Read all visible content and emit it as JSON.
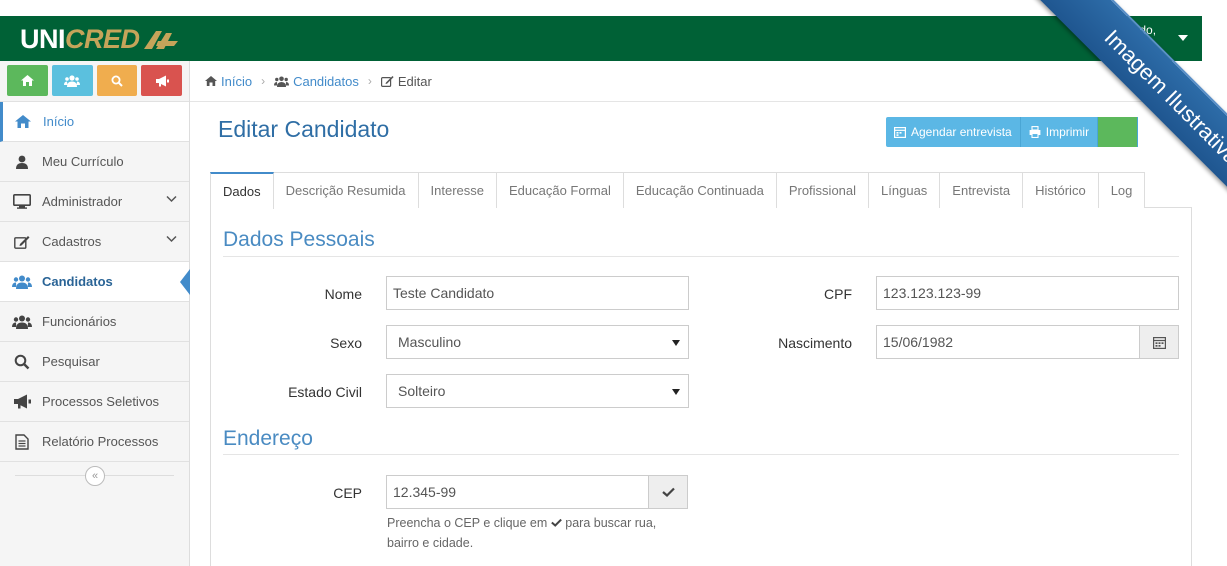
{
  "header": {
    "brand_part1": "UNI",
    "brand_part2": "CRED",
    "welcome": "em vindo,",
    "user_name": "erize"
  },
  "ribbon": {
    "text": "Imagem Ilustrativa"
  },
  "quick_buttons": [
    {
      "icon": "home-icon",
      "color": "#5cb85c"
    },
    {
      "icon": "users-icon",
      "color": "#5bc0de"
    },
    {
      "icon": "search-icon",
      "color": "#f0ad4e"
    },
    {
      "icon": "megaphone-icon",
      "color": "#d9534f"
    }
  ],
  "sidebar": {
    "items": [
      {
        "label": "Início",
        "icon": "home-icon"
      },
      {
        "label": "Meu Currículo",
        "icon": "user-icon"
      },
      {
        "label": "Administrador",
        "icon": "monitor-icon"
      },
      {
        "label": "Cadastros",
        "icon": "edit-icon"
      },
      {
        "label": "Candidatos",
        "icon": "users-icon"
      },
      {
        "label": "Funcionários",
        "icon": "users-icon"
      },
      {
        "label": "Pesquisar",
        "icon": "search-icon"
      },
      {
        "label": "Processos Seletivos",
        "icon": "megaphone-icon"
      },
      {
        "label": "Relatório Processos",
        "icon": "document-icon"
      }
    ]
  },
  "breadcrumb": {
    "home": "Início",
    "candidates": "Candidatos",
    "current": "Editar"
  },
  "page": {
    "title": "Editar Candidato",
    "actions": {
      "schedule": "Agendar entrevista",
      "print": "Imprimir"
    }
  },
  "tabs": [
    "Dados",
    "Descrição Resumida",
    "Interesse",
    "Educação Formal",
    "Educação Continuada",
    "Profissional",
    "Línguas",
    "Entrevista",
    "Histórico",
    "Log"
  ],
  "form": {
    "section_personal": "Dados Pessoais",
    "name_label": "Nome",
    "name_value": "Teste Candidato",
    "cpf_label": "CPF",
    "cpf_value": "123.123.123-99",
    "sex_label": "Sexo",
    "sex_value": "Masculino",
    "birth_label": "Nascimento",
    "birth_value": "15/06/1982",
    "civil_label": "Estado Civil",
    "civil_value": "Solteiro",
    "section_address": "Endereço",
    "cep_label": "CEP",
    "cep_value": "12.345-99",
    "cep_help_1": "Preencha o CEP e clique em",
    "cep_help_2": "para buscar rua, bairro e cidade."
  },
  "colors": {
    "header_green": "#006136",
    "brand_gold": "#c5a45a",
    "accent_blue": "#428bca",
    "ribbon_blue": "#2d6ca8"
  }
}
